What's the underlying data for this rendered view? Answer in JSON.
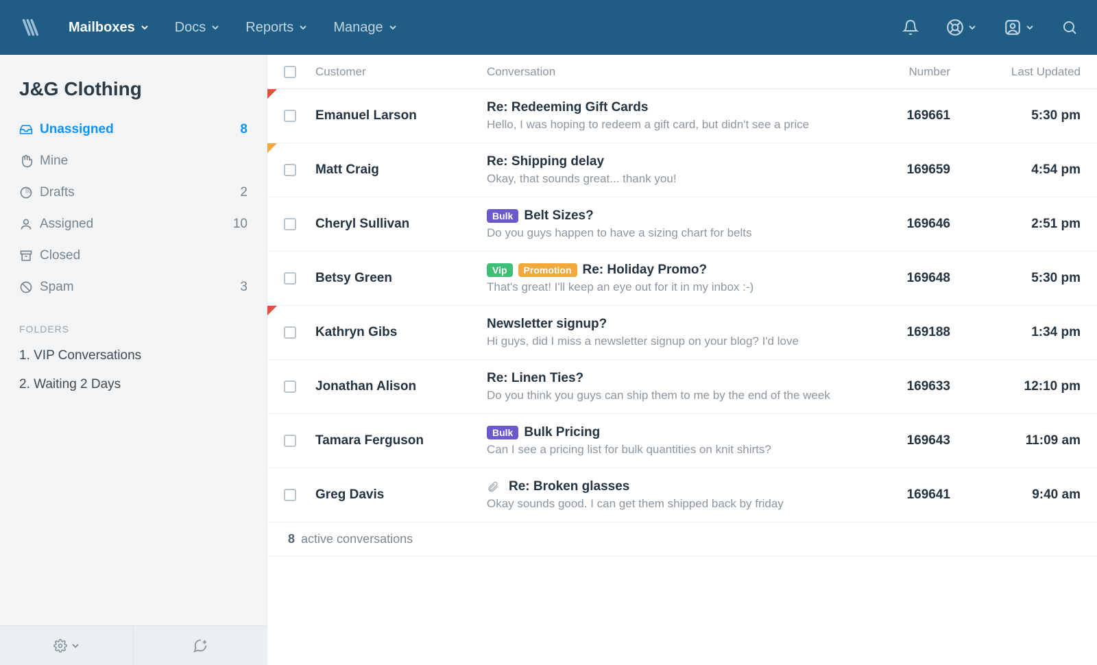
{
  "topnav": {
    "items": [
      {
        "label": "Mailboxes",
        "active": true
      },
      {
        "label": "Docs"
      },
      {
        "label": "Reports"
      },
      {
        "label": "Manage"
      }
    ]
  },
  "sidebar": {
    "mailbox_title": "J&G Clothing",
    "items": [
      {
        "label": "Unassigned",
        "count": "8",
        "icon": "inbox",
        "active": true
      },
      {
        "label": "Mine",
        "count": "",
        "icon": "hand"
      },
      {
        "label": "Drafts",
        "count": "2",
        "icon": "draft"
      },
      {
        "label": "Assigned",
        "count": "10",
        "icon": "person"
      },
      {
        "label": "Closed",
        "count": "",
        "icon": "archive"
      },
      {
        "label": "Spam",
        "count": "3",
        "icon": "block"
      }
    ],
    "folders_header": "FOLDERS",
    "folders": [
      {
        "label": "1. VIP Conversations"
      },
      {
        "label": "2. Waiting 2 Days"
      }
    ]
  },
  "table": {
    "headers": {
      "customer": "Customer",
      "conversation": "Conversation",
      "number": "Number",
      "updated": "Last Updated"
    },
    "rows": [
      {
        "customer": "Emanuel Larson",
        "subject": "Re: Redeeming Gift Cards",
        "preview": "Hello, I was hoping to redeem a gift card, but didn't see a price",
        "number": "169661",
        "updated": "5:30 pm",
        "flag": "red",
        "tags": [],
        "attachment": false
      },
      {
        "customer": "Matt Craig",
        "subject": "Re: Shipping delay",
        "preview": "Okay, that sounds great... thank you!",
        "number": "169659",
        "updated": "4:54 pm",
        "flag": "orange",
        "tags": [],
        "attachment": false
      },
      {
        "customer": "Cheryl Sullivan",
        "subject": "Belt Sizes?",
        "preview": "Do you guys happen to have a sizing chart for belts",
        "number": "169646",
        "updated": "2:51 pm",
        "flag": "",
        "tags": [
          "Bulk"
        ],
        "attachment": false
      },
      {
        "customer": "Betsy Green",
        "subject": "Re: Holiday Promo?",
        "preview": "That's great! I'll keep an eye out for it in my inbox :-)",
        "number": "169648",
        "updated": "5:30 pm",
        "flag": "",
        "tags": [
          "Vip",
          "Promotion"
        ],
        "attachment": false
      },
      {
        "customer": "Kathryn Gibs",
        "subject": "Newsletter signup?",
        "preview": "Hi guys, did I miss a newsletter signup on your blog? I'd love",
        "number": "169188",
        "updated": "1:34 pm",
        "flag": "red",
        "tags": [],
        "attachment": false
      },
      {
        "customer": "Jonathan Alison",
        "subject": "Re: Linen Ties?",
        "preview": "Do you think you guys can ship them to me by the end of the week",
        "number": "169633",
        "updated": "12:10 pm",
        "flag": "",
        "tags": [],
        "attachment": false
      },
      {
        "customer": "Tamara Ferguson",
        "subject": "Bulk Pricing",
        "preview": "Can I see a pricing list for bulk quantities on knit shirts?",
        "number": "169643",
        "updated": "11:09 am",
        "flag": "",
        "tags": [
          "Bulk"
        ],
        "attachment": false
      },
      {
        "customer": "Greg Davis",
        "subject": "Re: Broken glasses",
        "preview": "Okay sounds good. I can get them shipped back by friday",
        "number": "169641",
        "updated": "9:40 am",
        "flag": "",
        "tags": [],
        "attachment": true
      }
    ],
    "footer_count": "8",
    "footer_label": "active conversations"
  }
}
